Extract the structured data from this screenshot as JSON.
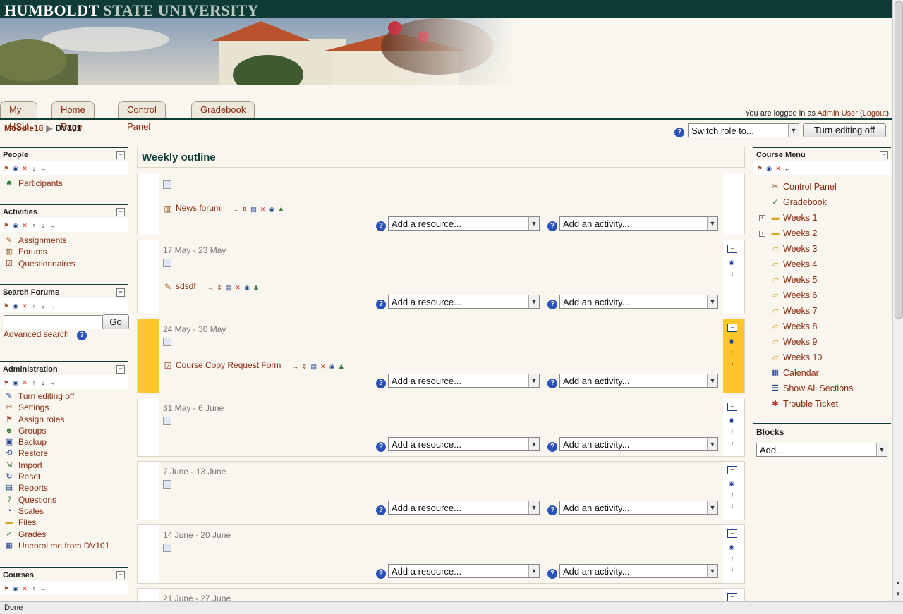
{
  "header": {
    "title_main": "HUMBOLDT",
    "title_sub": "STATE UNIVERSITY"
  },
  "tabs": [
    {
      "label": "My HSU"
    },
    {
      "label": "Home Page"
    },
    {
      "label": "Control Panel"
    },
    {
      "label": "Gradebook"
    }
  ],
  "login": {
    "prefix": "You are logged in as",
    "user": "Admin User",
    "logout": "Logout"
  },
  "breadcrumb": {
    "root": "Moodle18",
    "current": "DV101"
  },
  "toolbar": {
    "switch_role": "Switch role to...",
    "edit_button": "Turn editing off"
  },
  "left_blocks": {
    "people": {
      "title": "People",
      "items": [
        "Participants"
      ]
    },
    "activities": {
      "title": "Activities",
      "items": [
        "Assignments",
        "Forums",
        "Questionnaires"
      ]
    },
    "search": {
      "title": "Search Forums",
      "go": "Go",
      "advanced": "Advanced search"
    },
    "admin": {
      "title": "Administration",
      "items": [
        "Turn editing off",
        "Settings",
        "Assign roles",
        "Groups",
        "Backup",
        "Restore",
        "Import",
        "Reset",
        "Reports",
        "Questions",
        "Scales",
        "Files",
        "Grades",
        "Unenrol me from DV101"
      ]
    },
    "courses": {
      "title": "Courses"
    }
  },
  "main": {
    "title": "Weekly outline",
    "add_resource": "Add a resource...",
    "add_activity": "Add an activity...",
    "sections": [
      {
        "date": "",
        "activity": "News forum"
      },
      {
        "date": "17 May - 23 May",
        "activity": "sdsdf"
      },
      {
        "date": "24 May - 30 May",
        "activity": "Course Copy Request Form"
      },
      {
        "date": "31 May - 6 June",
        "activity": ""
      },
      {
        "date": "7 June - 13 June",
        "activity": ""
      },
      {
        "date": "14 June - 20 June",
        "activity": ""
      },
      {
        "date": "21 June - 27 June",
        "activity": ""
      }
    ]
  },
  "course_menu": {
    "title": "Course Menu",
    "items": [
      "Control Panel",
      "Gradebook",
      "Weeks 1",
      "Weeks 2",
      "Weeks 3",
      "Weeks 4",
      "Weeks 5",
      "Weeks 6",
      "Weeks 7",
      "Weeks 8",
      "Weeks 9",
      "Weeks 10",
      "Calendar",
      "Show All Sections",
      "Trouble Ticket"
    ]
  },
  "blocks": {
    "title": "Blocks",
    "add": "Add..."
  },
  "status": "Done"
}
